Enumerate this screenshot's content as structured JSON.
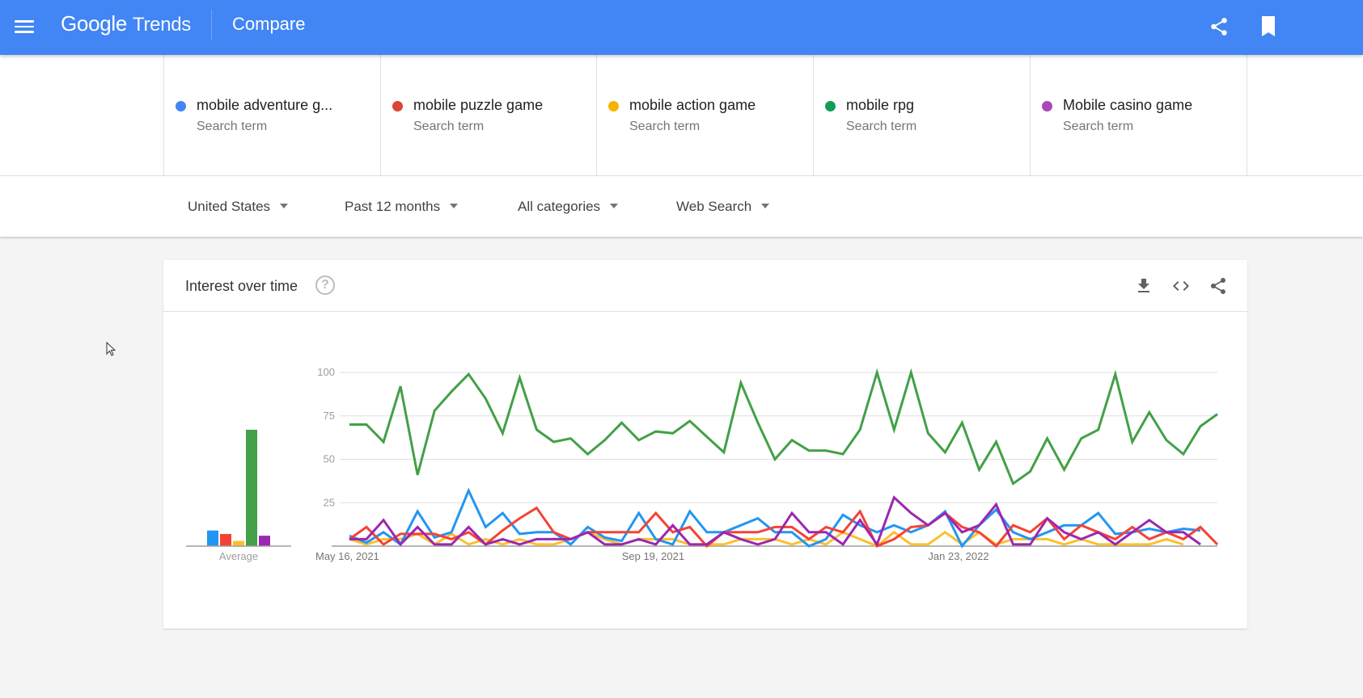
{
  "header": {
    "logo_google": "Google",
    "logo_trends": "Trends",
    "title": "Compare",
    "icons": [
      "menu-icon",
      "share-icon",
      "bookmark-icon"
    ]
  },
  "terms": [
    {
      "name": "mobile adventure g...",
      "subtitle": "Search term",
      "color": "#4285f4"
    },
    {
      "name": "mobile puzzle game",
      "subtitle": "Search term",
      "color": "#db4437"
    },
    {
      "name": "mobile action game",
      "subtitle": "Search term",
      "color": "#f4b400"
    },
    {
      "name": "mobile rpg",
      "subtitle": "Search term",
      "color": "#0f9d58"
    },
    {
      "name": "Mobile casino game",
      "subtitle": "Search term",
      "color": "#ab47bc"
    }
  ],
  "filters": {
    "region": "United States",
    "time": "Past 12 months",
    "category": "All categories",
    "property": "Web Search"
  },
  "card": {
    "title": "Interest over time",
    "help": "?",
    "icons": [
      "download-icon",
      "embed-icon",
      "share-icon"
    ]
  },
  "chart_data": {
    "type": "line",
    "title": "Interest over time",
    "xlabel": "",
    "ylabel": "",
    "ylim": [
      0,
      100
    ],
    "yticks": [
      25,
      50,
      75,
      100
    ],
    "grid": true,
    "x_tick_labels": [
      {
        "label": "May 16, 2021",
        "index": 0
      },
      {
        "label": "Sep 19, 2021",
        "index": 18
      },
      {
        "label": "Jan 23, 2022",
        "index": 36
      }
    ],
    "average": {
      "label": "Average",
      "values": [
        9,
        7,
        3,
        67,
        6
      ]
    },
    "series": [
      {
        "name": "mobile adventure game",
        "color": "#2196f3",
        "values": [
          6,
          2,
          8,
          1,
          20,
          5,
          8,
          32,
          11,
          19,
          7,
          8,
          8,
          1,
          11,
          5,
          3,
          19,
          4,
          1,
          20,
          8,
          8,
          12,
          16,
          8,
          8,
          0,
          4,
          18,
          12,
          8,
          12,
          8,
          12,
          20,
          0,
          12,
          21,
          8,
          4,
          8,
          12,
          12,
          19,
          7,
          8,
          10,
          8,
          10,
          9
        ]
      },
      {
        "name": "mobile puzzle game",
        "color": "#f44336",
        "values": [
          4,
          11,
          1,
          7,
          7,
          7,
          4,
          8,
          1,
          9,
          16,
          22,
          8,
          4,
          8,
          8,
          8,
          8,
          19,
          8,
          11,
          0,
          8,
          8,
          8,
          11,
          11,
          4,
          11,
          8,
          20,
          0,
          4,
          11,
          12,
          19,
          11,
          8,
          0,
          12,
          8,
          16,
          4,
          12,
          8,
          4,
          11,
          4,
          8,
          4,
          11,
          1
        ]
      },
      {
        "name": "mobile action game",
        "color": "#fbc02d",
        "values": [
          4,
          1,
          4,
          4,
          7,
          1,
          7,
          1,
          4,
          1,
          4,
          1,
          1,
          4,
          8,
          4,
          1,
          4,
          4,
          4,
          1,
          1,
          1,
          4,
          4,
          4,
          1,
          4,
          1,
          8,
          4,
          0,
          8,
          1,
          1,
          8,
          1,
          8,
          1,
          4,
          4,
          4,
          1,
          4,
          1,
          1,
          1,
          1,
          4,
          1
        ]
      },
      {
        "name": "mobile rpg",
        "color": "#43a047",
        "values": [
          70,
          70,
          60,
          92,
          41,
          78,
          89,
          99,
          85,
          65,
          97,
          67,
          60,
          62,
          53,
          61,
          71,
          61,
          66,
          65,
          72,
          63,
          54,
          94,
          71,
          50,
          61,
          55,
          55,
          53,
          67,
          100,
          67,
          100,
          65,
          54,
          71,
          44,
          60,
          36,
          43,
          62,
          44,
          62,
          67,
          99,
          60,
          77,
          61,
          53,
          69,
          76
        ]
      },
      {
        "name": "Mobile casino game",
        "color": "#9c27b0",
        "values": [
          4,
          4,
          15,
          1,
          11,
          1,
          1,
          11,
          1,
          4,
          1,
          4,
          4,
          4,
          8,
          1,
          1,
          4,
          1,
          12,
          1,
          1,
          8,
          4,
          1,
          4,
          19,
          8,
          8,
          1,
          15,
          1,
          28,
          19,
          12,
          19,
          8,
          12,
          24,
          1,
          1,
          16,
          8,
          4,
          8,
          1,
          8,
          15,
          8,
          8,
          1
        ]
      }
    ]
  },
  "cursor": "pointer-cursor"
}
